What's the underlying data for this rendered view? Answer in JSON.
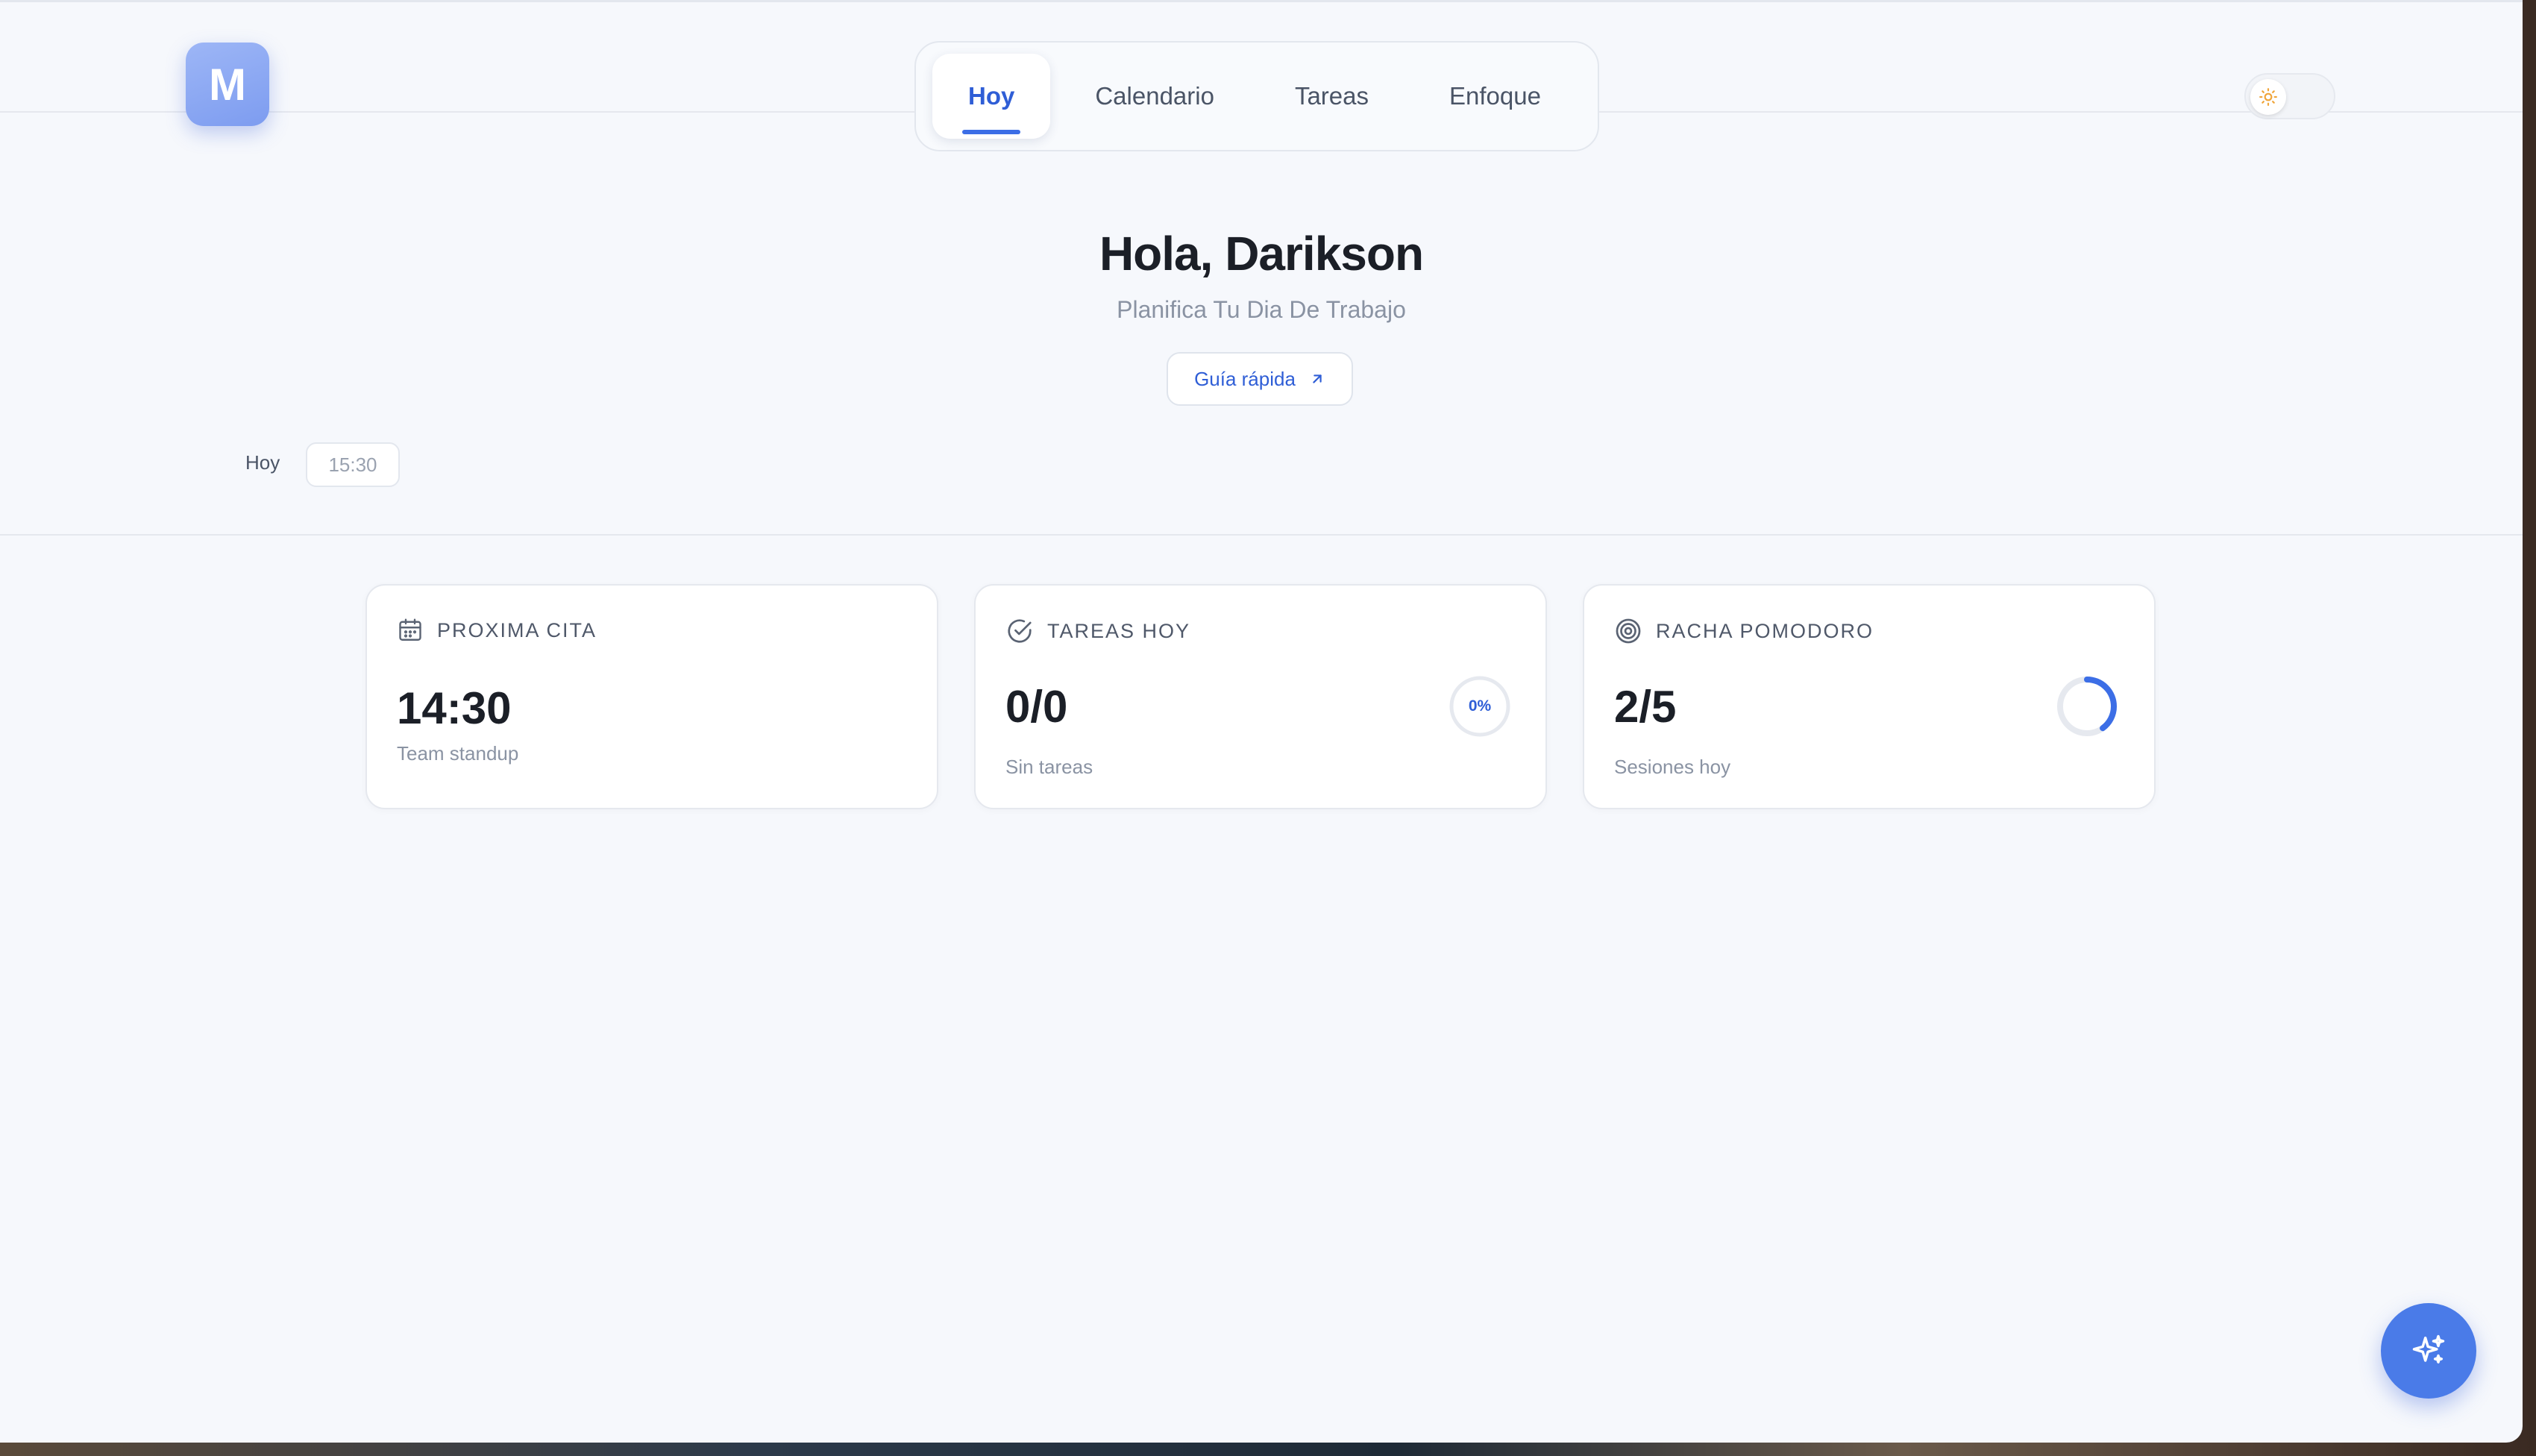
{
  "app": {
    "logo_letter": "M"
  },
  "nav": {
    "tabs": [
      {
        "label": "Hoy",
        "active": true
      },
      {
        "label": "Calendario",
        "active": false
      },
      {
        "label": "Tareas",
        "active": false
      },
      {
        "label": "Enfoque",
        "active": false
      }
    ]
  },
  "theme_toggle": {
    "mode": "light",
    "icon": "sun-icon"
  },
  "hero": {
    "greeting": "Hola, Darikson",
    "subtitle": "Planifica Tu Dia De Trabajo",
    "guide_button": "Guía rápida"
  },
  "date_row": {
    "label": "Hoy",
    "time": "15:30"
  },
  "cards": {
    "next_appointment": {
      "title": "PROXIMA CITA",
      "value": "14:30",
      "subtitle": "Team standup",
      "icon": "calendar-icon"
    },
    "tasks_today": {
      "title": "TAREAS HOY",
      "value": "0/0",
      "subtitle": "Sin tareas",
      "progress_label": "0%",
      "progress": 0,
      "icon": "check-circle-icon"
    },
    "pomodoro_streak": {
      "title": "RACHA POMODORO",
      "value": "2/5",
      "subtitle": "Sesiones hoy",
      "progress": 0.4,
      "icon": "target-icon"
    }
  },
  "fab": {
    "icon": "sparkles-icon"
  },
  "colors": {
    "accent": "#2f5ed6",
    "background": "#f6f8fc",
    "logo": "#8aa7f3",
    "fab": "#4a7be8"
  }
}
